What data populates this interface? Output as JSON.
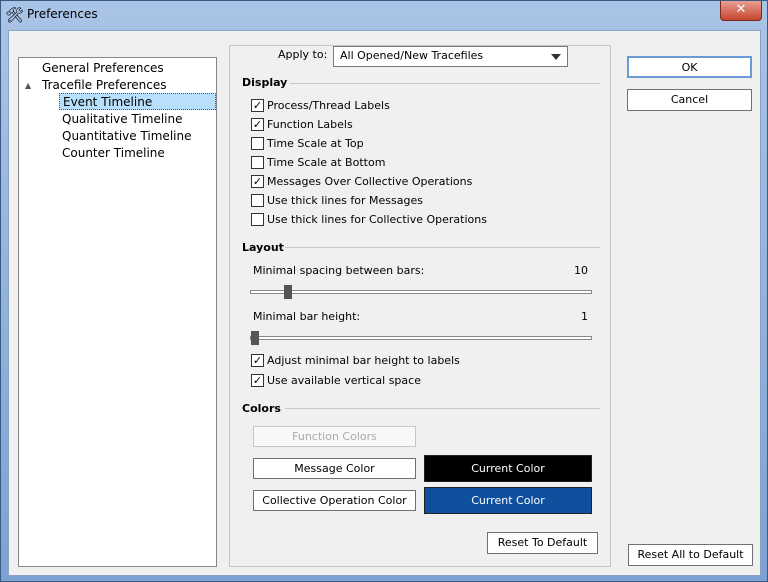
{
  "window": {
    "title": "Preferences",
    "close": "✕"
  },
  "tree": {
    "items": [
      {
        "label": "General Preferences"
      },
      {
        "label": "Tracefile Preferences",
        "expander": "▲"
      },
      {
        "label": "Event Timeline",
        "selected": true
      },
      {
        "label": "Qualitative Timeline"
      },
      {
        "label": "Quantitative Timeline"
      },
      {
        "label": "Counter Timeline"
      }
    ]
  },
  "apply": {
    "label": "Apply to:",
    "value": "All Opened/New Tracefiles"
  },
  "display": {
    "heading": "Display",
    "options": [
      {
        "label": "Process/Thread Labels",
        "checked": true
      },
      {
        "label": "Function Labels",
        "checked": true
      },
      {
        "label": "Time Scale at Top",
        "checked": false
      },
      {
        "label": "Time Scale at Bottom",
        "checked": false
      },
      {
        "label": "Messages Over Collective Operations",
        "checked": true
      },
      {
        "label": "Use thick lines for Messages",
        "checked": false
      },
      {
        "label": "Use thick lines for Collective Operations",
        "checked": false
      }
    ]
  },
  "layout": {
    "heading": "Layout",
    "spacing": {
      "label": "Minimal spacing between bars:",
      "value": "10",
      "fraction": 0.1
    },
    "height": {
      "label": "Minimal bar height:",
      "value": "1",
      "fraction": 0.0
    },
    "options": [
      {
        "label": "Adjust minimal bar height to labels",
        "checked": true
      },
      {
        "label": "Use available vertical space",
        "checked": true
      }
    ]
  },
  "colors": {
    "heading": "Colors",
    "function_colors": "Function Colors",
    "message_color": "Message Color",
    "message_current": "Current Color",
    "message_hex": "#000000",
    "collective_color": "Collective Operation Color",
    "collective_current": "Current Color",
    "collective_hex": "#0e4f9e"
  },
  "buttons": {
    "reset": "Reset To Default",
    "ok": "OK",
    "cancel": "Cancel",
    "reset_all": "Reset All to Default"
  }
}
